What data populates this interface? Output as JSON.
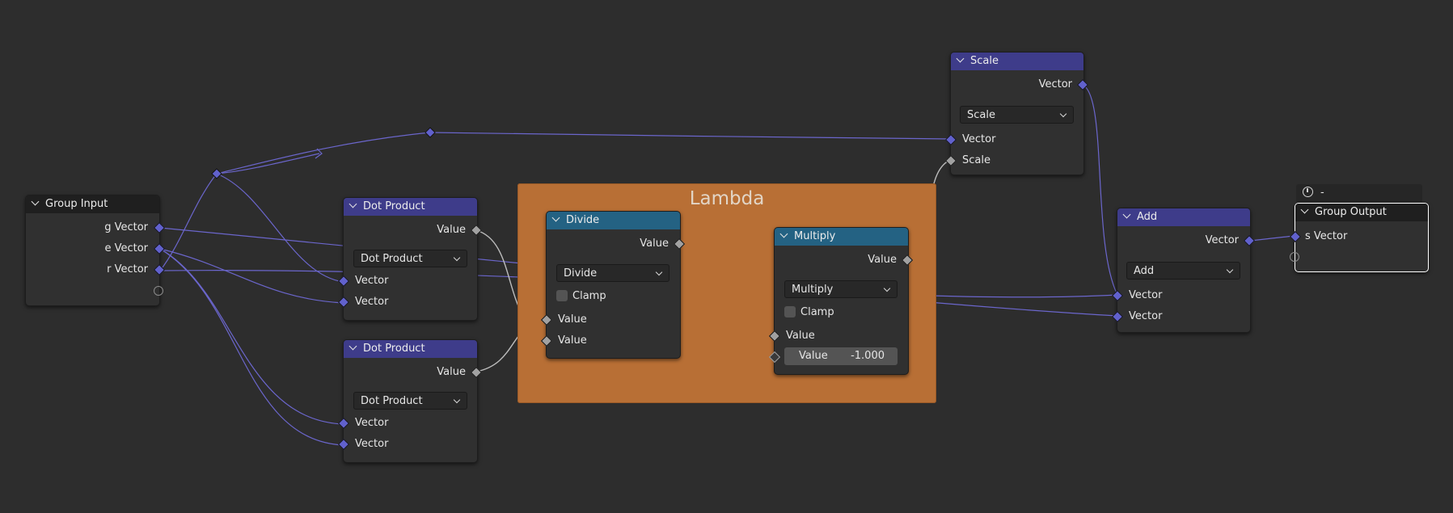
{
  "frame": {
    "label": "Lambda",
    "color": "#b86f35"
  },
  "colors": {
    "vector_socket": "#6161cd",
    "value_socket": "#a1a1a1",
    "vector_header": "#3e3c8a",
    "converter_header": "#246283",
    "link": "#6b66cc"
  },
  "nodes": {
    "group_input": {
      "title": "Group Input",
      "outputs": [
        "g Vector",
        "e Vector",
        "r Vector"
      ]
    },
    "dot1": {
      "title": "Dot Product",
      "output": "Value",
      "mode": "Dot Product",
      "inputs": [
        "Vector",
        "Vector"
      ]
    },
    "dot2": {
      "title": "Dot Product",
      "output": "Value",
      "mode": "Dot Product",
      "inputs": [
        "Vector",
        "Vector"
      ]
    },
    "divide": {
      "title": "Divide",
      "output": "Value",
      "mode": "Divide",
      "clamp": "Clamp",
      "inputs": [
        "Value",
        "Value"
      ]
    },
    "multiply": {
      "title": "Multiply",
      "output": "Value",
      "mode": "Multiply",
      "clamp": "Clamp",
      "input": "Value",
      "field_label": "Value",
      "field_value": "-1.000"
    },
    "scale": {
      "title": "Scale",
      "output": "Vector",
      "mode": "Scale",
      "inputs": [
        "Vector",
        "Scale"
      ]
    },
    "add": {
      "title": "Add",
      "output": "Vector",
      "mode": "Add",
      "inputs": [
        "Vector",
        "Vector"
      ]
    },
    "group_output": {
      "title": "Group Output",
      "timer": "-",
      "input": "s Vector"
    }
  }
}
